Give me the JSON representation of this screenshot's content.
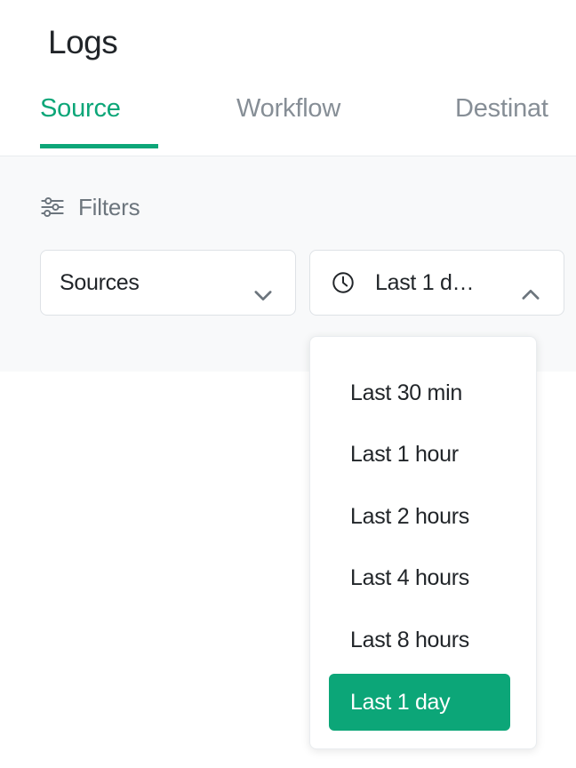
{
  "header": {
    "title": "Logs",
    "tabs": [
      {
        "label": "Source",
        "active": true
      },
      {
        "label": "Workflow",
        "active": false
      },
      {
        "label": "Destinat",
        "active": false
      }
    ]
  },
  "filters": {
    "icon": "sliders-icon",
    "label": "Filters",
    "sources_select": {
      "value": "Sources",
      "chevron": "chevron-down-icon"
    },
    "time_select": {
      "icon": "clock-icon",
      "value": "Last 1 d…",
      "chevron": "chevron-up-icon"
    }
  },
  "time_dropdown": {
    "options": [
      {
        "label": "Last 30 min",
        "selected": false
      },
      {
        "label": "Last 1 hour",
        "selected": false
      },
      {
        "label": "Last 2 hours",
        "selected": false
      },
      {
        "label": "Last 4 hours",
        "selected": false
      },
      {
        "label": "Last 8 hours",
        "selected": false
      },
      {
        "label": "Last 1 day",
        "selected": true
      }
    ]
  },
  "colors": {
    "accent": "#0ca678",
    "text": "#212529",
    "muted": "#868e96",
    "bar_bg": "#f8f9fa",
    "border": "#dee2e6"
  }
}
